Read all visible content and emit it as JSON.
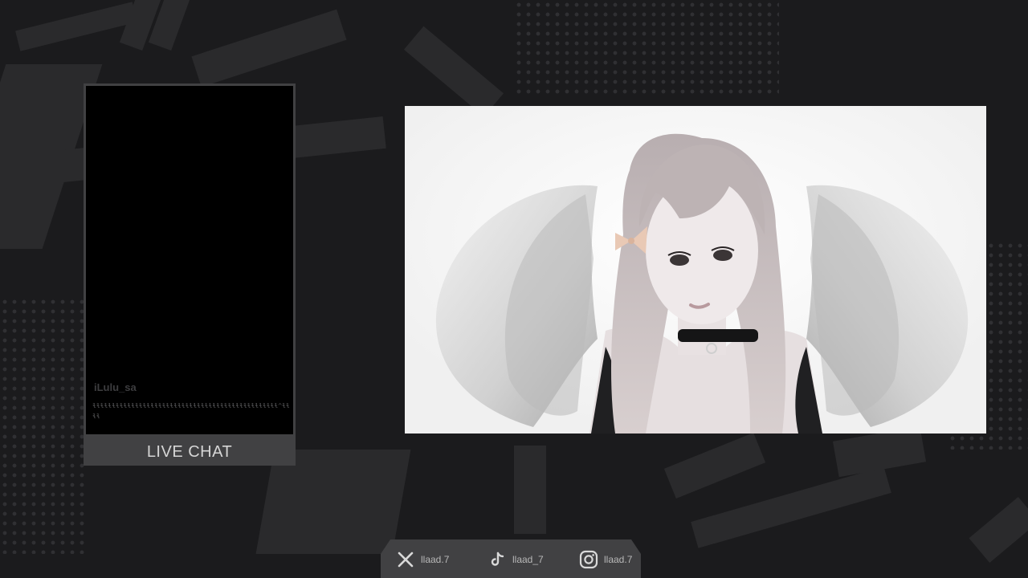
{
  "chat": {
    "label": "LIVE CHAT",
    "username": "iLulu_sa",
    "message": "ɬɬɬɬɬɬɬɬɬɬɬɬɬɬɬɬɬɬɬɬɬɬɬɬɬɬɬɬɬɬɬɬɬɬɬɬɬɬɬɬɬɬɬɬɬɬɬɬ^ɬɬɬɬ"
  },
  "socials": [
    {
      "icon": "x-icon",
      "handle": "llaad.7"
    },
    {
      "icon": "tiktok-icon",
      "handle": "llaad_7"
    },
    {
      "icon": "instagram-icon",
      "handle": "llaad.7"
    }
  ],
  "colors": {
    "background": "#1b1b1d",
    "panel": "#414143",
    "chat_background": "#000000",
    "video_background": "#ffffff"
  }
}
